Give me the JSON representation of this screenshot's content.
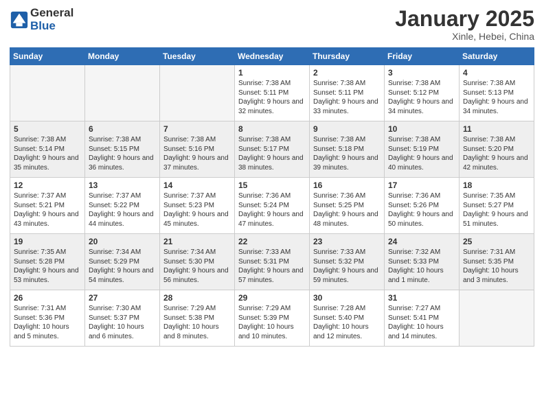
{
  "header": {
    "logo_general": "General",
    "logo_blue": "Blue",
    "month_title": "January 2025",
    "location": "Xinle, Hebei, China"
  },
  "weekdays": [
    "Sunday",
    "Monday",
    "Tuesday",
    "Wednesday",
    "Thursday",
    "Friday",
    "Saturday"
  ],
  "weeks": [
    [
      {
        "day": "",
        "empty": true
      },
      {
        "day": "",
        "empty": true
      },
      {
        "day": "",
        "empty": true
      },
      {
        "day": "1",
        "sunrise": "7:38 AM",
        "sunset": "5:11 PM",
        "daylight": "9 hours and 32 minutes."
      },
      {
        "day": "2",
        "sunrise": "7:38 AM",
        "sunset": "5:11 PM",
        "daylight": "9 hours and 33 minutes."
      },
      {
        "day": "3",
        "sunrise": "7:38 AM",
        "sunset": "5:12 PM",
        "daylight": "9 hours and 34 minutes."
      },
      {
        "day": "4",
        "sunrise": "7:38 AM",
        "sunset": "5:13 PM",
        "daylight": "9 hours and 34 minutes."
      }
    ],
    [
      {
        "day": "5",
        "sunrise": "7:38 AM",
        "sunset": "5:14 PM",
        "daylight": "9 hours and 35 minutes."
      },
      {
        "day": "6",
        "sunrise": "7:38 AM",
        "sunset": "5:15 PM",
        "daylight": "9 hours and 36 minutes."
      },
      {
        "day": "7",
        "sunrise": "7:38 AM",
        "sunset": "5:16 PM",
        "daylight": "9 hours and 37 minutes."
      },
      {
        "day": "8",
        "sunrise": "7:38 AM",
        "sunset": "5:17 PM",
        "daylight": "9 hours and 38 minutes."
      },
      {
        "day": "9",
        "sunrise": "7:38 AM",
        "sunset": "5:18 PM",
        "daylight": "9 hours and 39 minutes."
      },
      {
        "day": "10",
        "sunrise": "7:38 AM",
        "sunset": "5:19 PM",
        "daylight": "9 hours and 40 minutes."
      },
      {
        "day": "11",
        "sunrise": "7:38 AM",
        "sunset": "5:20 PM",
        "daylight": "9 hours and 42 minutes."
      }
    ],
    [
      {
        "day": "12",
        "sunrise": "7:37 AM",
        "sunset": "5:21 PM",
        "daylight": "9 hours and 43 minutes."
      },
      {
        "day": "13",
        "sunrise": "7:37 AM",
        "sunset": "5:22 PM",
        "daylight": "9 hours and 44 minutes."
      },
      {
        "day": "14",
        "sunrise": "7:37 AM",
        "sunset": "5:23 PM",
        "daylight": "9 hours and 45 minutes."
      },
      {
        "day": "15",
        "sunrise": "7:36 AM",
        "sunset": "5:24 PM",
        "daylight": "9 hours and 47 minutes."
      },
      {
        "day": "16",
        "sunrise": "7:36 AM",
        "sunset": "5:25 PM",
        "daylight": "9 hours and 48 minutes."
      },
      {
        "day": "17",
        "sunrise": "7:36 AM",
        "sunset": "5:26 PM",
        "daylight": "9 hours and 50 minutes."
      },
      {
        "day": "18",
        "sunrise": "7:35 AM",
        "sunset": "5:27 PM",
        "daylight": "9 hours and 51 minutes."
      }
    ],
    [
      {
        "day": "19",
        "sunrise": "7:35 AM",
        "sunset": "5:28 PM",
        "daylight": "9 hours and 53 minutes."
      },
      {
        "day": "20",
        "sunrise": "7:34 AM",
        "sunset": "5:29 PM",
        "daylight": "9 hours and 54 minutes."
      },
      {
        "day": "21",
        "sunrise": "7:34 AM",
        "sunset": "5:30 PM",
        "daylight": "9 hours and 56 minutes."
      },
      {
        "day": "22",
        "sunrise": "7:33 AM",
        "sunset": "5:31 PM",
        "daylight": "9 hours and 57 minutes."
      },
      {
        "day": "23",
        "sunrise": "7:33 AM",
        "sunset": "5:32 PM",
        "daylight": "9 hours and 59 minutes."
      },
      {
        "day": "24",
        "sunrise": "7:32 AM",
        "sunset": "5:33 PM",
        "daylight": "10 hours and 1 minute."
      },
      {
        "day": "25",
        "sunrise": "7:31 AM",
        "sunset": "5:35 PM",
        "daylight": "10 hours and 3 minutes."
      }
    ],
    [
      {
        "day": "26",
        "sunrise": "7:31 AM",
        "sunset": "5:36 PM",
        "daylight": "10 hours and 5 minutes."
      },
      {
        "day": "27",
        "sunrise": "7:30 AM",
        "sunset": "5:37 PM",
        "daylight": "10 hours and 6 minutes."
      },
      {
        "day": "28",
        "sunrise": "7:29 AM",
        "sunset": "5:38 PM",
        "daylight": "10 hours and 8 minutes."
      },
      {
        "day": "29",
        "sunrise": "7:29 AM",
        "sunset": "5:39 PM",
        "daylight": "10 hours and 10 minutes."
      },
      {
        "day": "30",
        "sunrise": "7:28 AM",
        "sunset": "5:40 PM",
        "daylight": "10 hours and 12 minutes."
      },
      {
        "day": "31",
        "sunrise": "7:27 AM",
        "sunset": "5:41 PM",
        "daylight": "10 hours and 14 minutes."
      },
      {
        "day": "",
        "empty": true
      }
    ]
  ]
}
